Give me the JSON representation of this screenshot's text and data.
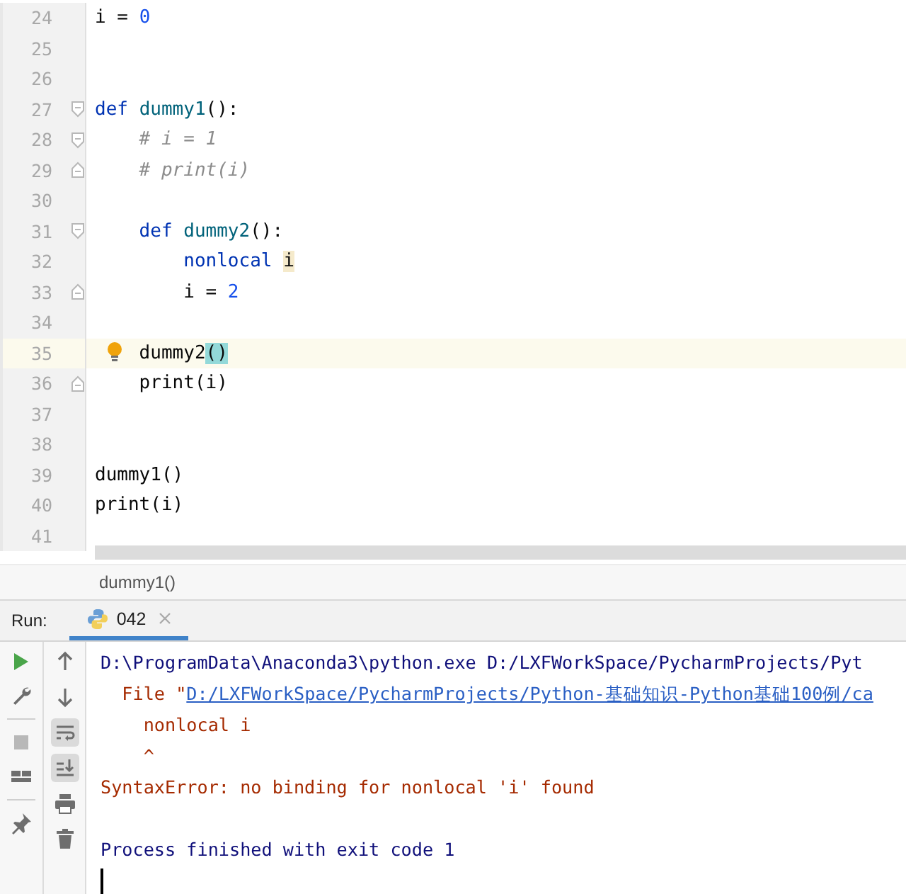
{
  "editor": {
    "lines": [
      {
        "number": "24",
        "tokens": [
          {
            "text": "i = ",
            "kind": "plain"
          },
          {
            "text": "0",
            "kind": "number"
          }
        ]
      },
      {
        "number": "25"
      },
      {
        "number": "26"
      },
      {
        "number": "27",
        "fold_start": true,
        "tokens": [
          {
            "text": "def ",
            "kind": "keyword"
          },
          {
            "text": "dummy1",
            "kind": "function"
          },
          {
            "text": "():",
            "kind": "plain"
          }
        ]
      },
      {
        "number": "28",
        "fold_start": true,
        "tokens": [
          {
            "text": "    # i = 1",
            "kind": "comment"
          }
        ]
      },
      {
        "number": "29",
        "fold_end": true,
        "tokens": [
          {
            "text": "    # print(i)",
            "kind": "comment"
          }
        ]
      },
      {
        "number": "30"
      },
      {
        "number": "31",
        "fold_start": true,
        "tokens": [
          {
            "text": "    def ",
            "kind": "keyword"
          },
          {
            "text": "dummy2",
            "kind": "function"
          },
          {
            "text": "():",
            "kind": "plain"
          }
        ]
      },
      {
        "number": "32",
        "tokens": [
          {
            "text": "        nonlocal ",
            "kind": "keyword"
          },
          {
            "text": "i",
            "kind": "usage"
          }
        ]
      },
      {
        "number": "33",
        "fold_end": true,
        "tokens": [
          {
            "text": "        i = ",
            "kind": "plain"
          },
          {
            "text": "2",
            "kind": "number"
          }
        ]
      },
      {
        "number": "34"
      },
      {
        "number": "35",
        "current": true,
        "intention": true,
        "tokens": [
          {
            "text": "    dummy2",
            "kind": "plain"
          },
          {
            "text": "()",
            "kind": "brace-match"
          }
        ]
      },
      {
        "number": "36",
        "fold_end": true,
        "tokens": [
          {
            "text": "    print(i)",
            "kind": "plain"
          }
        ]
      },
      {
        "number": "37"
      },
      {
        "number": "38"
      },
      {
        "number": "39",
        "tokens": [
          {
            "text": "dummy1()",
            "kind": "plain"
          }
        ]
      },
      {
        "number": "40",
        "tokens": [
          {
            "text": "print(i)",
            "kind": "plain"
          }
        ]
      },
      {
        "number": "41"
      }
    ]
  },
  "breadcrumb": "dummy1()",
  "run_panel": {
    "label": "Run:",
    "tabs": [
      {
        "label": "042",
        "selected": true
      }
    ],
    "toolbar_left": [
      {
        "kind": "run",
        "disabled": false
      },
      {
        "kind": "wrench",
        "disabled": false
      },
      {
        "kind": "separator"
      },
      {
        "kind": "stop",
        "disabled": true
      },
      {
        "kind": "layout",
        "disabled": false
      },
      {
        "kind": "separator"
      },
      {
        "kind": "pin",
        "disabled": false
      }
    ],
    "toolbar_right": [
      {
        "kind": "up",
        "toggled": false
      },
      {
        "kind": "down",
        "toggled": false
      },
      {
        "kind": "wrap",
        "toggled": true
      },
      {
        "kind": "scroll-end",
        "toggled": true
      },
      {
        "kind": "print",
        "toggled": false
      },
      {
        "kind": "trash",
        "toggled": false
      }
    ],
    "console": [
      {
        "kind": "text",
        "tokens": [
          {
            "text": "D:\\ProgramData\\Anaconda3\\python.exe D:/LXFWorkSpace/PycharmProjects/Pyt",
            "kind": "system"
          }
        ]
      },
      {
        "kind": "text",
        "tokens": [
          {
            "text": "  File \"",
            "kind": "error"
          },
          {
            "text": "D:/LXFWorkSpace/PycharmProjects/Python-基础知识-Python基础100例/ca",
            "kind": "link"
          }
        ]
      },
      {
        "kind": "text",
        "tokens": [
          {
            "text": "    nonlocal i",
            "kind": "error"
          }
        ]
      },
      {
        "kind": "text",
        "tokens": [
          {
            "text": "    ^",
            "kind": "error"
          }
        ]
      },
      {
        "kind": "text",
        "tokens": [
          {
            "text": "SyntaxError: no binding for nonlocal 'i' found",
            "kind": "error"
          }
        ]
      },
      {
        "kind": "blank"
      },
      {
        "kind": "text",
        "tokens": [
          {
            "text": "Process finished with exit code 1",
            "kind": "system"
          }
        ]
      },
      {
        "kind": "cursor"
      }
    ]
  }
}
